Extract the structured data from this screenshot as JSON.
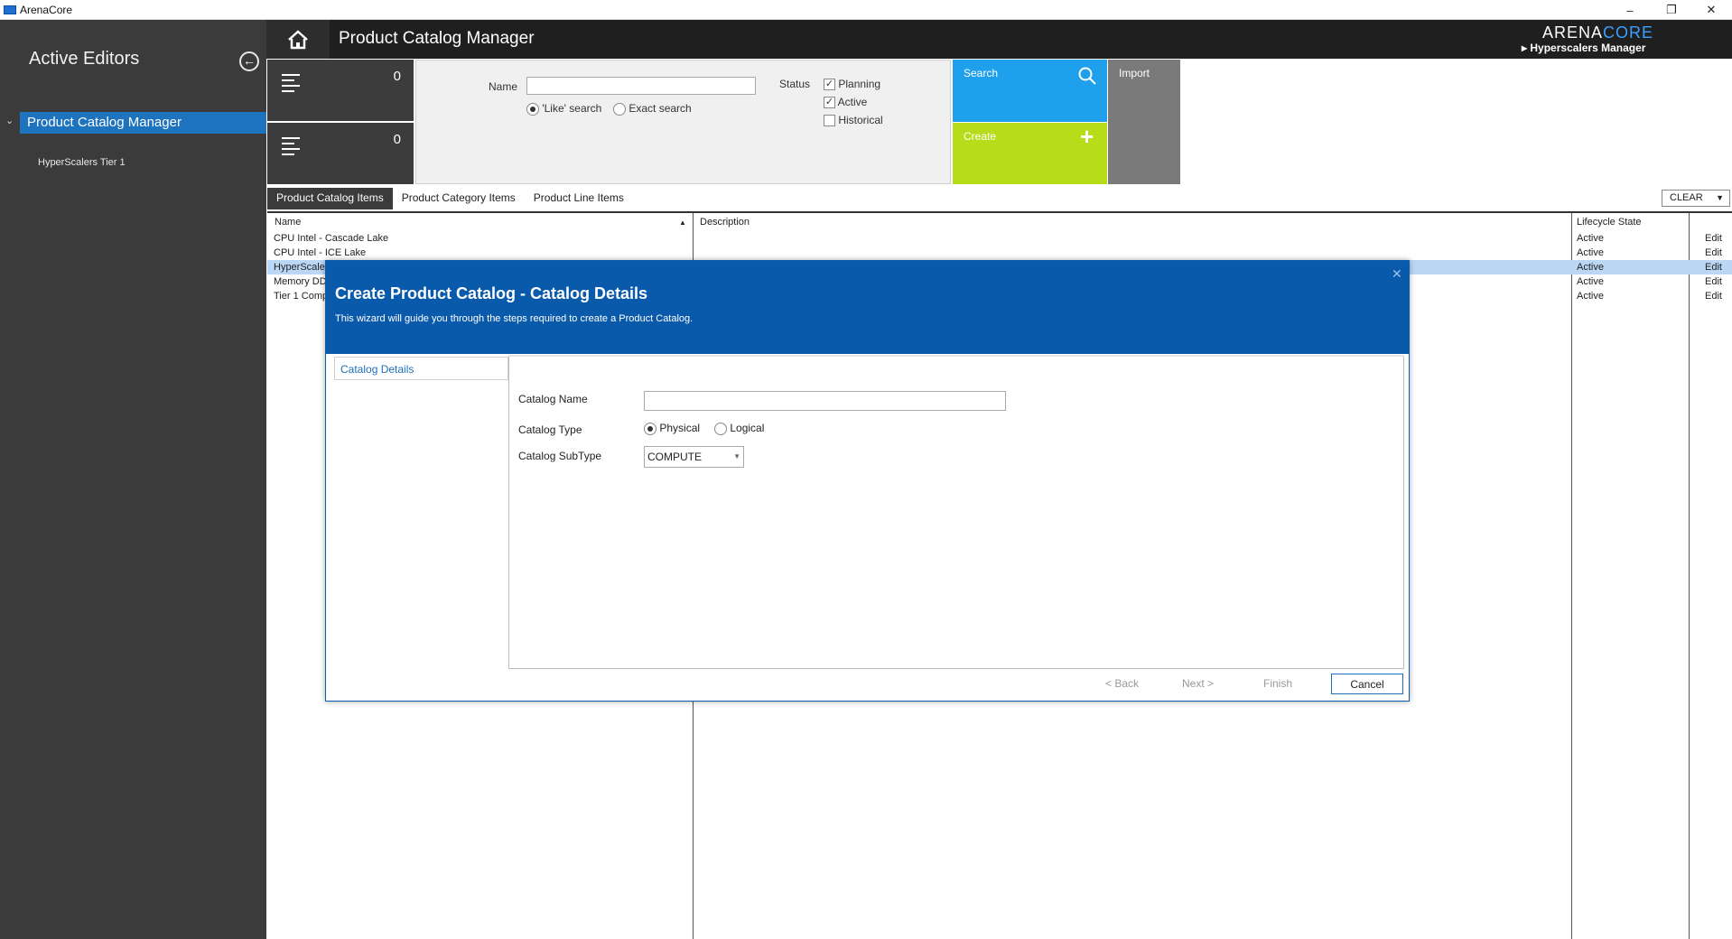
{
  "window": {
    "title": "ArenaCore",
    "minimize": "–",
    "restore": "❐",
    "close": "✕"
  },
  "sidebar": {
    "title": "Active Editors",
    "back_icon": "←",
    "tree_caret": "⌄",
    "item": "Product Catalog Manager",
    "sub_item": "HyperScalers Tier 1"
  },
  "header": {
    "page_title": "Product Catalog Manager",
    "brand_arena": "ARENA",
    "brand_core": "CORE",
    "brand_sub": "Hyperscalers Manager",
    "brand_caret": "▸"
  },
  "counters": [
    {
      "value": "0"
    },
    {
      "value": "0"
    }
  ],
  "search": {
    "name_label": "Name",
    "name_value": "",
    "like_label": "'Like' search",
    "exact_label": "Exact search",
    "status_label": "Status",
    "statuses": [
      {
        "label": "Planning",
        "checked": true
      },
      {
        "label": "Active",
        "checked": true
      },
      {
        "label": "Historical",
        "checked": false
      }
    ]
  },
  "tiles": {
    "search": "Search",
    "create": "Create",
    "import": "Import",
    "search_icon": "search-icon",
    "create_icon": "plus-icon"
  },
  "tabs": [
    "Product Catalog Items",
    "Product Category Items",
    "Product Line Items"
  ],
  "clear_label": "CLEAR",
  "grid": {
    "headers": {
      "name": "Name",
      "description": "Description",
      "lifecycle": "Lifecycle State",
      "sort_icon": "▲"
    },
    "rows": [
      {
        "name": "CPU Intel - Cascade Lake",
        "state": "Active",
        "action": "Edit"
      },
      {
        "name": "CPU Intel - ICE Lake",
        "state": "Active",
        "action": "Edit"
      },
      {
        "name": "HyperScaler",
        "state": "Active",
        "action": "Edit"
      },
      {
        "name": "Memory DDF",
        "state": "Active",
        "action": "Edit"
      },
      {
        "name": "Tier 1 Comp",
        "state": "Active",
        "action": "Edit"
      }
    ]
  },
  "dialog": {
    "title": "Create Product Catalog - Catalog Details",
    "subtitle": "This wizard will guide you through the steps required to create a Product Catalog.",
    "close": "✕",
    "step": "Catalog Details",
    "catalog_name_label": "Catalog Name",
    "catalog_name_value": "",
    "catalog_type_label": "Catalog Type",
    "type_physical": "Physical",
    "type_logical": "Logical",
    "subtype_label": "Catalog SubType",
    "subtype_value": "COMPUTE",
    "back": "< Back",
    "next": "Next >",
    "finish": "Finish",
    "cancel": "Cancel"
  }
}
